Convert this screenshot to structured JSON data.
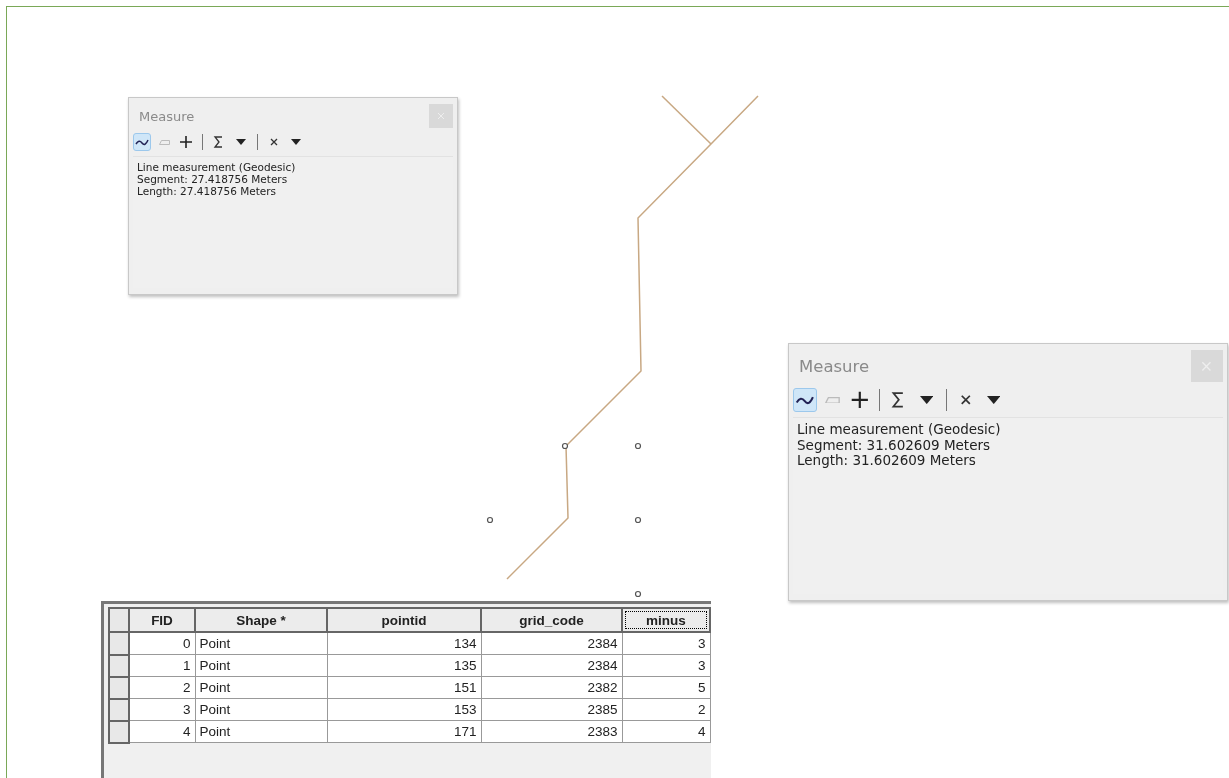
{
  "measure_windows": [
    {
      "kind": "small",
      "title": "Measure",
      "tools": [
        {
          "kind": "line",
          "selected": true
        },
        {
          "kind": "area",
          "selected": false
        },
        {
          "kind": "point",
          "selected": false
        },
        {
          "kind": "sum",
          "selected": false
        },
        {
          "kind": "clear",
          "selected": false
        }
      ],
      "lines": [
        "Line measurement (Geodesic)",
        "Segment: 27.418756 Meters",
        "Length: 27.418756 Meters"
      ]
    },
    {
      "kind": "large",
      "title": "Measure",
      "tools": [
        {
          "kind": "line",
          "selected": true
        },
        {
          "kind": "area",
          "selected": false
        },
        {
          "kind": "point",
          "selected": false
        },
        {
          "kind": "sum",
          "selected": false
        },
        {
          "kind": "clear",
          "selected": false
        }
      ],
      "lines": [
        "Line measurement (Geodesic)",
        "Segment: 31.602609 Meters",
        "Length: 31.602609 Meters"
      ]
    }
  ],
  "table": {
    "columns": [
      {
        "label": "FID",
        "selected": false
      },
      {
        "label": "Shape *",
        "selected": false
      },
      {
        "label": "pointid",
        "selected": false
      },
      {
        "label": "grid_code",
        "selected": false
      },
      {
        "label": "minus",
        "selected": true
      }
    ],
    "rows": [
      [
        "0",
        "Point",
        "134",
        "2384",
        "3"
      ],
      [
        "1",
        "Point",
        "135",
        "2384",
        "3"
      ],
      [
        "2",
        "Point",
        "151",
        "2382",
        "5"
      ],
      [
        "3",
        "Point",
        "153",
        "2385",
        "2"
      ],
      [
        "4",
        "Point",
        "171",
        "2383",
        "4"
      ]
    ]
  }
}
